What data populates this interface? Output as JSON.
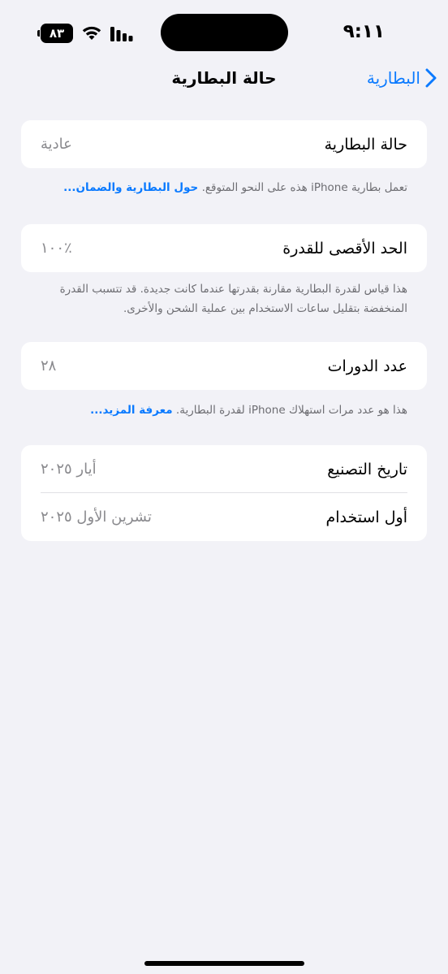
{
  "status_bar": {
    "time": "٩:١١",
    "battery_level": "٨٣",
    "icons": [
      "battery-icon",
      "wifi-icon",
      "signal-icon"
    ]
  },
  "nav": {
    "back_label": "البطارية",
    "title": "حالة البطارية"
  },
  "sections": {
    "condition": {
      "label": "حالة البطارية",
      "value": "عادية",
      "footnote_text": "تعمل بطارية iPhone هذه على النحو المتوقع. ",
      "footnote_link": "حول البطارية والضمان..."
    },
    "max_capacity": {
      "label": "الحد الأقصى للقدرة",
      "value": "٪١٠٠",
      "footnote_text": "هذا قياس لقدرة البطارية مقارنة بقدرتها عندما كانت جديدة. قد تتسبب القدرة المنخفضة بتقليل ساعات الاستخدام بين عملية الشحن والأخرى."
    },
    "cycle_count": {
      "label": "عدد الدورات",
      "value": "٢٨",
      "footnote_text": "هذا هو عدد مرات استهلاك iPhone لقدرة البطارية. ",
      "footnote_link": "معرفة المزيد..."
    },
    "dates": {
      "manufacture_label": "تاريخ التصنيع",
      "manufacture_value": "أيار ٢٠٢٥",
      "first_use_label": "أول استخدام",
      "first_use_value": "تشرين الأول ٢٠٢٥"
    }
  },
  "colors": {
    "background": "#f2f2f7",
    "accent": "#0a7aff",
    "secondary_text": "#8a8a8e"
  }
}
